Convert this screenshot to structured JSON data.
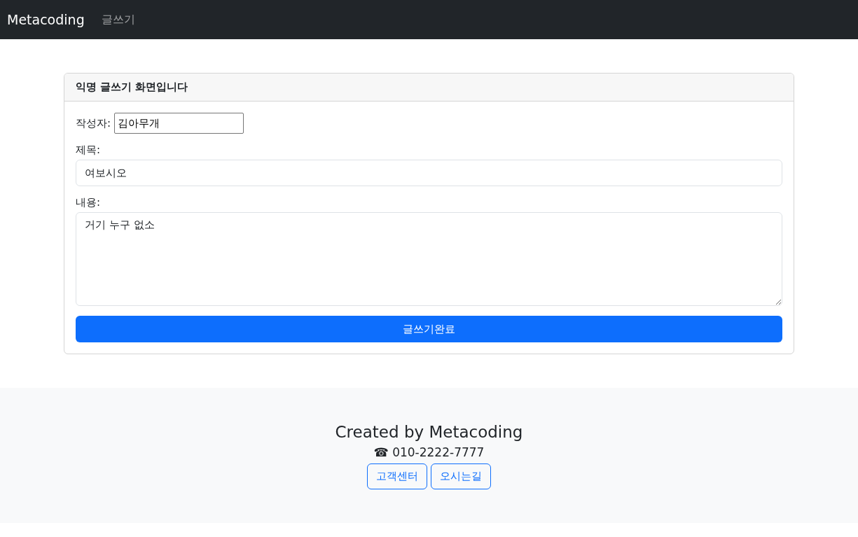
{
  "navbar": {
    "brand": "Metacoding",
    "links": [
      {
        "label": "글쓰기"
      }
    ]
  },
  "card": {
    "header": "익명 글쓰기 화면입니다",
    "author": {
      "label": "작성자:",
      "value": "김아무개"
    },
    "title": {
      "label": "제목:",
      "value": "여보시오"
    },
    "content": {
      "label": "내용:",
      "value": "거기 누구 없소"
    },
    "submit": "글쓰기완료"
  },
  "footer": {
    "credit": "Created by Metacoding",
    "phone": "☎ 010-2222-7777",
    "buttons": [
      "고객센터",
      "오시는길"
    ]
  }
}
